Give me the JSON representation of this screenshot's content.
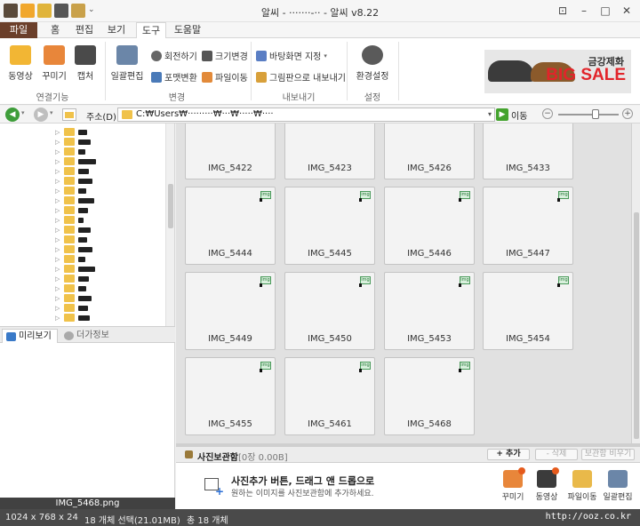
{
  "title": "알씨 - ·······-·· - 알씨 v8.22",
  "menu": {
    "file": "파일",
    "home": "홈",
    "edit": "편집",
    "view": "보기",
    "tools": "도구",
    "help": "도움말"
  },
  "ribbon": {
    "video": "동영상",
    "decorate": "꾸미기",
    "capture": "캡처",
    "batch_edit": "일괄편집",
    "rotate": "회전하기",
    "resize": "크기변경",
    "format_convert": "포맷변환",
    "file_move": "파일이동",
    "set_wallpaper": "바탕화면 지정",
    "export_clipboard": "그림판으로 내보내기",
    "settings": "환경설정",
    "group_link": "연결기능",
    "group_change": "변경",
    "group_export": "내보내기",
    "group_settings": "설정"
  },
  "ad": {
    "line1": "금강제화",
    "line2": "BIG SALE"
  },
  "address": {
    "label": "주소(D)",
    "path": "C:₩Users₩·········₩···₩·····₩····",
    "go": "이동"
  },
  "preview_tabs": {
    "preview": "미리보기",
    "more_info": "더가정보"
  },
  "preview_filename": "IMG_5468.png",
  "thumbnails": [
    "IMG_5422",
    "IMG_5423",
    "IMG_5426",
    "IMG_5433",
    "IMG_5444",
    "IMG_5445",
    "IMG_5446",
    "IMG_5447",
    "IMG_5449",
    "IMG_5450",
    "IMG_5453",
    "IMG_5454",
    "IMG_5455",
    "IMG_5461",
    "IMG_5468"
  ],
  "storage": {
    "title": "사진보관함",
    "count": "[0장 0.00B]",
    "add": "+ 추가",
    "delete": "- 삭제",
    "empty": "보관함 비우기",
    "prompt_title": "사진추가 버튼, 드래그 앤 드롭으로",
    "prompt_desc": "원하는 이미지를 사진보관함에 추가하세요.",
    "actions": {
      "decorate": "꾸미기",
      "video": "동영상",
      "file_move": "파일이동",
      "batch_edit": "일괄편집"
    }
  },
  "status": {
    "dimensions": "1024 x 768 x 24",
    "selection": "18 개체 선택(21.01MB)",
    "total": "총 18 개체",
    "watermark": "http://ooz.co.kr"
  },
  "colors": {
    "file_tab": "#6b3f2a",
    "ad_red": "#e2242a",
    "go_green": "#44a32e",
    "status_bg": "#4a4a4a"
  },
  "zoom_level": 0.6
}
